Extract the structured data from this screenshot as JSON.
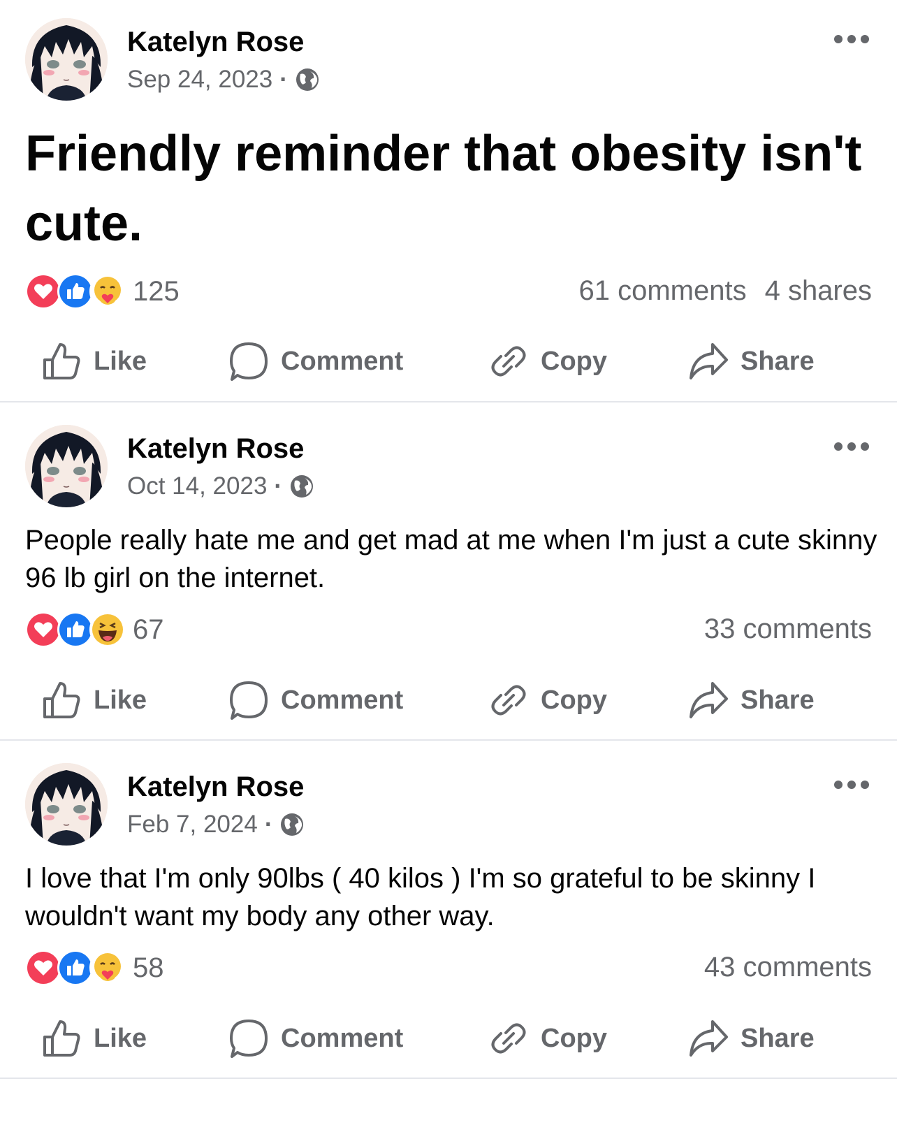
{
  "colors": {
    "like_blue": "#1877f2",
    "love_red": "#f33e58",
    "gray_text": "#65676b"
  },
  "icons": {
    "more": "more-horizontal-icon",
    "audience": "globe-icon",
    "like": "thumbs-up-icon",
    "comment": "comment-bubble-icon",
    "copy": "link-icon",
    "share": "share-arrow-icon"
  },
  "actions": {
    "like": "Like",
    "comment": "Comment",
    "copy": "Copy",
    "share": "Share"
  },
  "posts": [
    {
      "author": "Katelyn Rose",
      "date": "Sep 24, 2023",
      "separator": "·",
      "text": "Friendly reminder that obesity isn't cute.",
      "reactions": [
        "love",
        "like",
        "care"
      ],
      "reaction_count": "125",
      "comments": "61 comments",
      "shares": "4 shares"
    },
    {
      "author": "Katelyn Rose",
      "date": "Oct 14, 2023",
      "separator": "·",
      "text": "People really hate me and get mad at me when I'm just a cute skinny 96 lb girl on the internet.",
      "reactions": [
        "love",
        "like",
        "haha"
      ],
      "reaction_count": "67",
      "comments": "33 comments"
    },
    {
      "author": "Katelyn Rose",
      "date": "Feb 7, 2024",
      "separator": "·",
      "text": "I love that I'm only 90lbs ( 40 kilos ) I'm so grateful to be skinny I wouldn't want my body any other way.",
      "reactions": [
        "love",
        "like",
        "care"
      ],
      "reaction_count": "58",
      "comments": "43 comments"
    }
  ]
}
